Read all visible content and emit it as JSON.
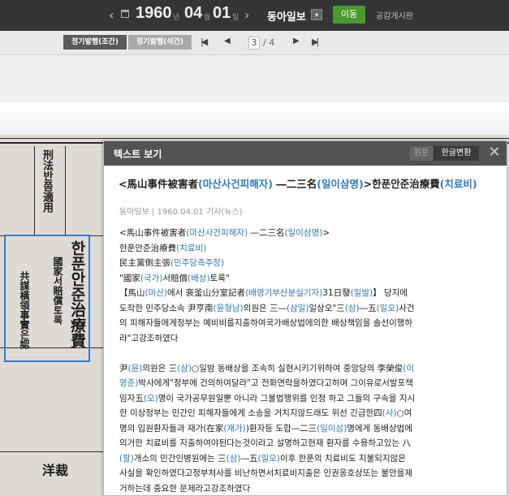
{
  "header": {
    "prev_arrow": "‹",
    "next_arrow": "›",
    "year": "1960",
    "year_unit": "년",
    "month": "04",
    "month_unit": "월",
    "day": "01",
    "day_unit": "일",
    "newspaper": "동아일보",
    "dropdown_glyph": "▾",
    "go_label": "이동",
    "board_label": "공감게시판"
  },
  "toolbar": {
    "edition_morning": "정기발행(조간)",
    "edition_evening": "정기발행(석간)",
    "current_page": "3",
    "total_pages": "/ 4",
    "first_glyph": "|◀",
    "prev_glyph": "◀",
    "next_glyph": "▶",
    "last_glyph": "▶|"
  },
  "newspaper_glyphs": {
    "headline_1": "刑法반쯤適用",
    "headline_2": "한푼안준治療費",
    "headline_3": "國家서賠償토록",
    "headline_4": "共謀橫領事實은認",
    "headline_5": "洋裁"
  },
  "modal": {
    "title": "텍스트 보기",
    "tab_original": "원문",
    "tab_translated": "한글변환",
    "close": "✕",
    "article_title_segments": [
      {
        "t": "<馬山事件被害者",
        "hl": false
      },
      {
        "t": "(마산사건피해자)",
        "hl": true
      },
      {
        "t": " ―二三名",
        "hl": false
      },
      {
        "t": "(일이삼명)",
        "hl": true
      },
      {
        "t": ">한푼안준治療費",
        "hl": false
      },
      {
        "t": "(치료비)",
        "hl": true
      }
    ],
    "meta": "동아일보 | 1960.04.01 기사(뉴스)",
    "paragraphs": [
      [
        [
          {
            "t": "<馬山事件被害者",
            "hl": false
          },
          {
            "t": "(마산사건피해자)",
            "hl": true
          },
          {
            "t": " ―二三名",
            "hl": false
          },
          {
            "t": "(일이삼명)",
            "hl": true
          },
          {
            "t": ">",
            "hl": false
          }
        ],
        [
          {
            "t": "한푼안준治療費",
            "hl": false
          },
          {
            "t": "(치료비)",
            "hl": true
          }
        ],
        [
          {
            "t": "民主黨側主張",
            "hl": false
          },
          {
            "t": "(민주당측주장)",
            "hl": true
          }
        ],
        [
          {
            "t": "\"國家",
            "hl": false
          },
          {
            "t": "(국가)",
            "hl": true
          },
          {
            "t": "서賠償",
            "hl": false
          },
          {
            "t": "(배상)",
            "hl": true
          },
          {
            "t": "토록\"",
            "hl": false
          }
        ],
        [
          {
            "t": "【馬山",
            "hl": false
          },
          {
            "t": "(마산)",
            "hl": true
          },
          {
            "t": "에서 裵釜山分室記者",
            "hl": false
          },
          {
            "t": "(배영기부산분실기자)",
            "hl": true
          },
          {
            "t": "31日發",
            "hl": false
          },
          {
            "t": "(일발)",
            "hl": true
          },
          {
            "t": "】 당지에",
            "hl": false
          }
        ],
        [
          {
            "t": "도착한 민주당소속 尹亨南",
            "hl": false
          },
          {
            "t": "(윤형남)",
            "hl": true
          },
          {
            "t": "의원은 三―",
            "hl": false
          },
          {
            "t": "(삼일)",
            "hl": true
          },
          {
            "t": "일상오\"三",
            "hl": false
          },
          {
            "t": "(삼)",
            "hl": true
          },
          {
            "t": "―五",
            "hl": false
          },
          {
            "t": "(일오)",
            "hl": true
          },
          {
            "t": "사건",
            "hl": false
          }
        ],
        [
          {
            "t": "의 피해자들에게정부는 예비비를지출하여국가배상법에의한 배상책임을 솔선이행하",
            "hl": false
          }
        ],
        [
          {
            "t": "라\"고강조하였다",
            "hl": false
          }
        ]
      ],
      [
        [
          {
            "t": "尹",
            "hl": false
          },
          {
            "t": "(윤)",
            "hl": true
          },
          {
            "t": "의원은 三",
            "hl": false
          },
          {
            "t": "(삼)",
            "hl": true
          },
          {
            "t": "○일밤 동배상을 조속히 실현시키기위하여 중앙당의 李榮俊",
            "hl": false
          },
          {
            "t": "(이",
            "hl": true
          }
        ],
        [
          {
            "t": "영준)",
            "hl": true
          },
          {
            "t": "박사에게\"정부에 건의하여달라\"고 전화연락을하였다고하며 그이유로서발포책",
            "hl": false
          }
        ],
        [
          {
            "t": "임자五",
            "hl": false
          },
          {
            "t": "(오)",
            "hl": true
          },
          {
            "t": "명이 국가공무원일뿐 아니라 그불법행위를 인정 하고 그들의 구속을 지시",
            "hl": false
          }
        ],
        [
          {
            "t": "한 이상정부는 민간인 피해자들에게 소송을 거치지않드래도 위선 긴급한四",
            "hl": false
          },
          {
            "t": "(사)",
            "hl": true
          },
          {
            "t": "○여",
            "hl": false
          }
        ],
        [
          {
            "t": "명의 입원환자들과 재가",
            "hl": false
          },
          {
            "t": "(在家",
            "hl": false
          },
          {
            "t": "(재가)",
            "hl": true
          },
          {
            "t": ")환자등 도합―二三",
            "hl": false
          },
          {
            "t": "(일이삼)",
            "hl": true
          },
          {
            "t": "명에게 동배상법에",
            "hl": false
          }
        ],
        [
          {
            "t": "의거한 치료비를 지출하여야된다는것이라고 설명하고현재 환자를 수용하고있는 八",
            "hl": false
          }
        ],
        [
          {
            "t": "(팔)",
            "hl": true
          },
          {
            "t": "개소의 민간인병원에는 三",
            "hl": false
          },
          {
            "t": "(삼)",
            "hl": true
          },
          {
            "t": "―五",
            "hl": false
          },
          {
            "t": "(일오)",
            "hl": true
          },
          {
            "t": "이후 한푼의 치료비도 지불되지않은",
            "hl": false
          }
        ],
        [
          {
            "t": "사실을 확인하였다고정부처사를 비난하면서치료비지출은 인권옹호상또는 불안을제",
            "hl": false
          }
        ],
        [
          {
            "t": "거하는데 중요한 문제라고강조하였다",
            "hl": false
          }
        ]
      ]
    ]
  }
}
